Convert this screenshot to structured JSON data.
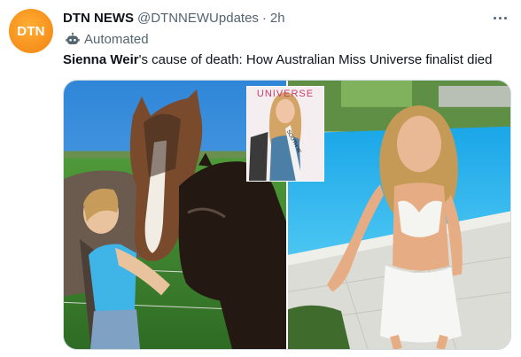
{
  "author": {
    "avatar_text": "DTN",
    "display_name": "DTN NEWS",
    "handle": "@DTNNEWUpdates",
    "separator": "·",
    "time": "2h",
    "avatar_color": "#f7931e"
  },
  "label": {
    "automated": "Automated",
    "icon": "robot-icon"
  },
  "tweet": {
    "highlight": "Sienna Weir",
    "text_rest": "'s cause of death: How Australian Miss Universe finalist died"
  },
  "media": {
    "inset_banner_text": "UNIVERSE",
    "sash_text": "SOUTH W",
    "photos": [
      "photo-horses",
      "photo-pool"
    ]
  },
  "colors": {
    "text": "#0f1419",
    "secondary": "#536471",
    "border": "#cfd9de"
  }
}
